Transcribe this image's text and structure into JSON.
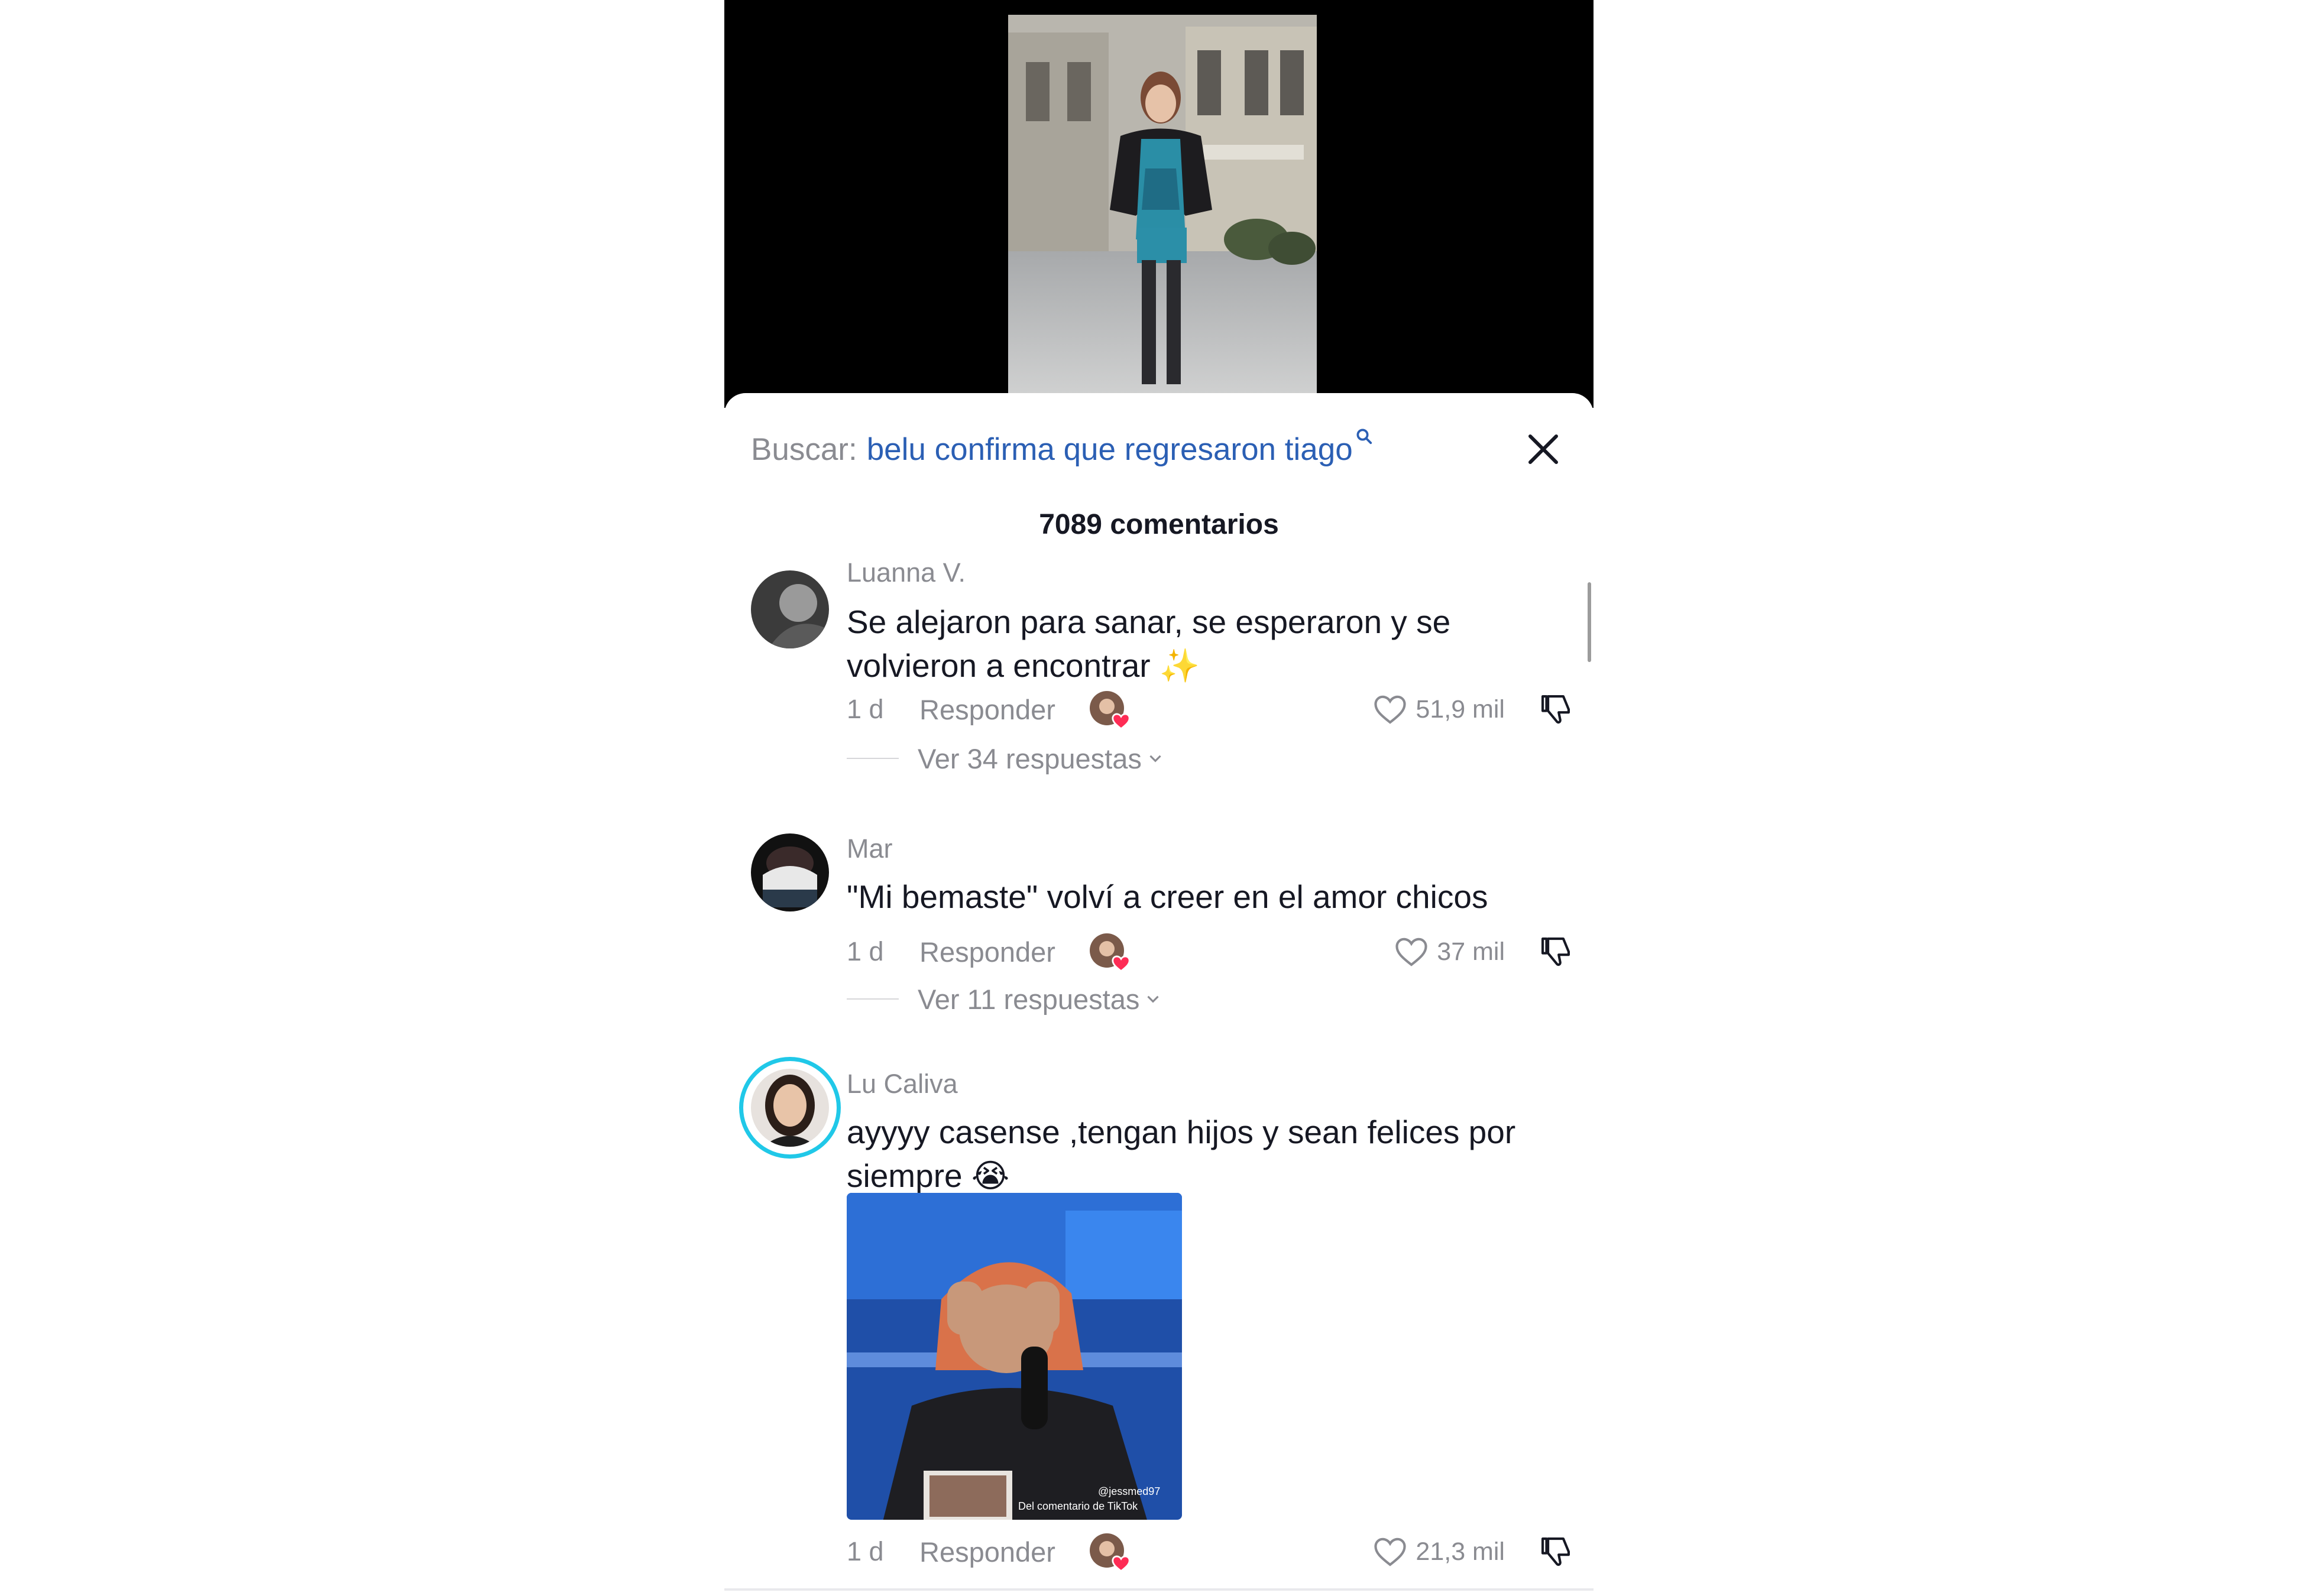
{
  "video": {
    "description_icon": "video-thumbnail"
  },
  "search": {
    "label": "Buscar:",
    "query": "belu confirma que regresaron tiago",
    "icon": "search-icon"
  },
  "comments_header": {
    "count_text": "7089 comentarios"
  },
  "comments": [
    {
      "username": "Luanna V.",
      "text": "Se alejaron para sanar, se esperaron y se volvieron a encontrar ✨",
      "age": "1 d",
      "reply_label": "Responder",
      "likes": "51,9 mil",
      "view_replies": "Ver 34 respuestas"
    },
    {
      "username": "Mar",
      "text": "\"Mi bemaste\" volví a creer en el amor chicos",
      "age": "1 d",
      "reply_label": "Responder",
      "likes": "37 mil",
      "view_replies": "Ver 11 respuestas"
    },
    {
      "username": "Lu Caliva",
      "text": "ayyyy casense ,tengan hijos y sean felices por siempre 😭",
      "age": "1 d",
      "reply_label": "Responder",
      "likes": "21,3 mil",
      "gif_caption_user": "@jessmed97",
      "gif_caption_source": "Del comentario de TikTok"
    }
  ],
  "colors": {
    "accent_blue": "#2b5fb4",
    "secondary_text": "#8a8b91",
    "heart_red": "#fe2c55",
    "story_ring": "#20c8e8"
  }
}
